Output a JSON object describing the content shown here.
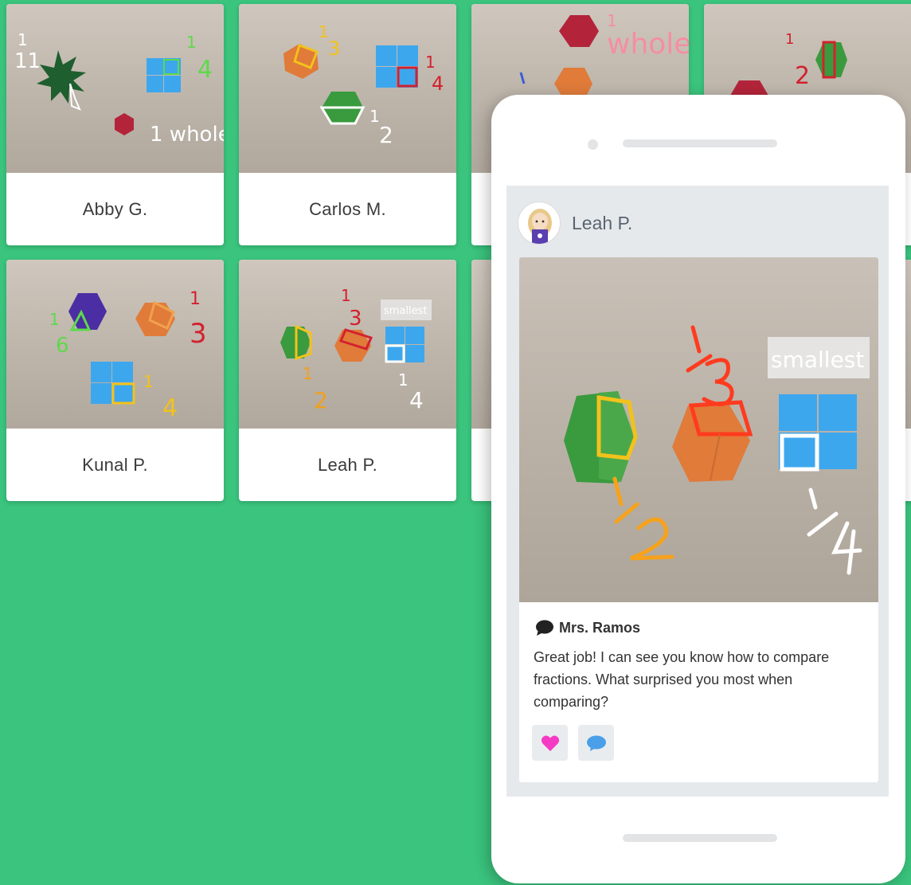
{
  "gallery": {
    "cards": [
      {
        "name": "Abby G.",
        "labels": [
          "1",
          "11",
          "1",
          "4",
          "1 whole"
        ]
      },
      {
        "name": "Carlos M.",
        "labels": [
          "1",
          "3",
          "1",
          "4",
          "1",
          "2"
        ]
      },
      {
        "name": "",
        "labels": [
          "1",
          "whole"
        ]
      },
      {
        "name": "",
        "labels": [
          "1",
          "2"
        ]
      },
      {
        "name": "Kunal P.",
        "labels": [
          "1",
          "6",
          "1",
          "3",
          "1",
          "4"
        ]
      },
      {
        "name": "Leah P.",
        "labels": [
          "1",
          "3",
          "smallest",
          "1",
          "2",
          "1",
          "4"
        ]
      }
    ]
  },
  "post": {
    "author": "Leah P.",
    "photo_labels": {
      "third": "1/3",
      "half": "1/2",
      "quarter": "1/4",
      "smallest": "smallest"
    },
    "comment": {
      "author": "Mrs. Ramos",
      "text": "Great job! I can see you know how to compare fractions. What surprised you most when comparing?"
    }
  },
  "colors": {
    "background": "#3AC47D",
    "heart": "#F53BC4",
    "speech_bubble": "#4A9FE8",
    "green_shape": "#3A9A3E",
    "orange_shape": "#E07B3A",
    "blue_shape": "#3DA7EE",
    "red_shape": "#B3243A",
    "purple_shape": "#4B2EA3",
    "dark_green_shape": "#1E5E2F"
  },
  "icons": [
    "comment-icon",
    "heart-icon",
    "speech-bubble-icon",
    "avatar"
  ]
}
